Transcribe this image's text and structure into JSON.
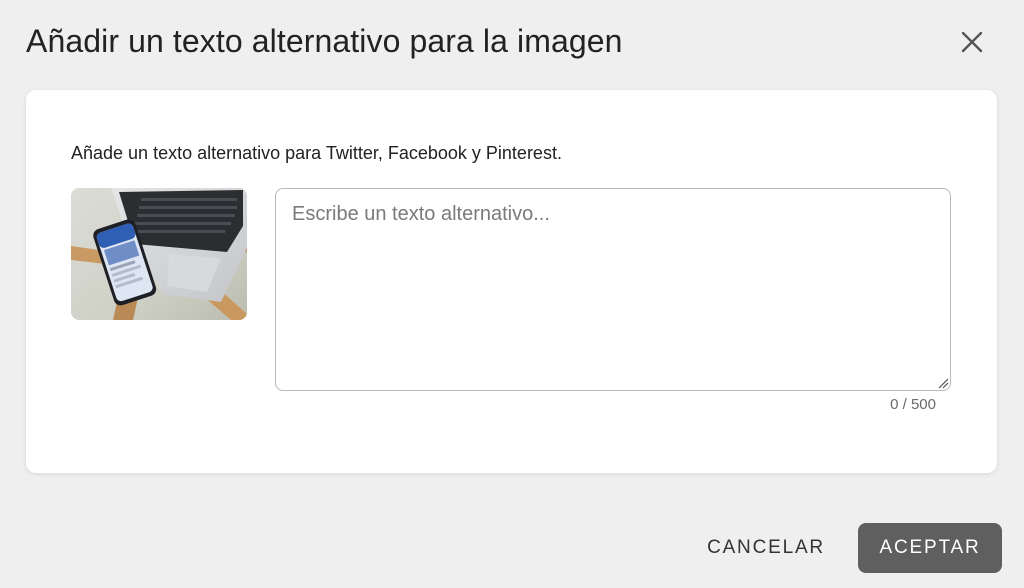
{
  "dialog": {
    "title": "Añadir un texto alternativo para la imagen",
    "close_icon": "close-icon"
  },
  "content": {
    "helper_text": "Añade un texto alternativo para Twitter, Facebook y Pinterest.",
    "image_description_icon": "photo-thumbnail",
    "textarea": {
      "placeholder": "Escribe un texto alternativo...",
      "value": ""
    },
    "char_counter": "0 / 500"
  },
  "footer": {
    "cancel_label": "CANCELAR",
    "accept_label": "ACEPTAR"
  },
  "colors": {
    "background": "#efefef",
    "card": "#ffffff",
    "accept_button": "#5f5f5f",
    "textarea_border": "#b9b9b9"
  }
}
